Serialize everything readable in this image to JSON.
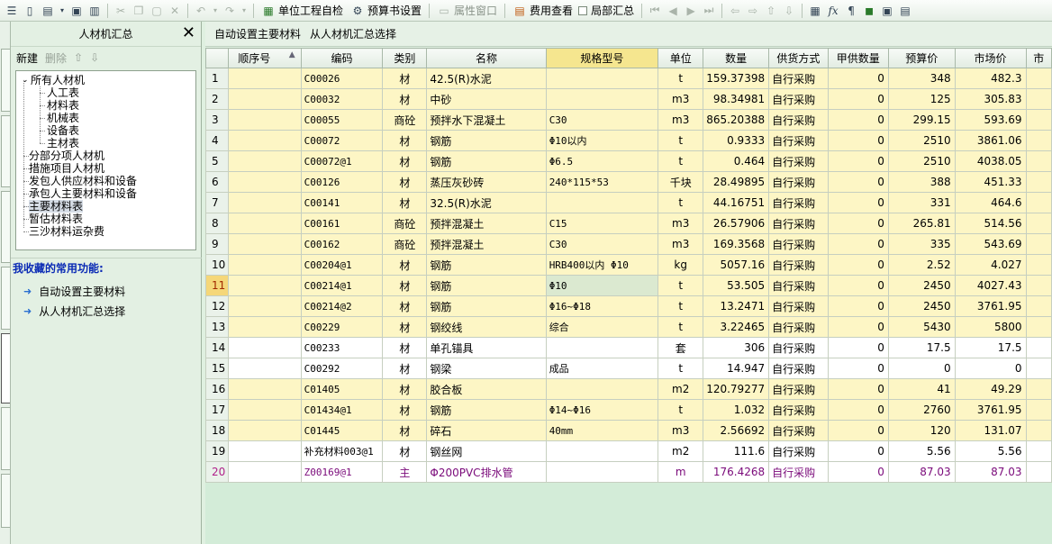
{
  "toolbar": {
    "check_label": "单位工程自检",
    "budget_settings_label": "预算书设置",
    "property_window_label": "属性窗口",
    "fee_view_label": "费用查看",
    "partial_summary_label": "局部汇总"
  },
  "left_panel": {
    "title": "人材机汇总",
    "new_label": "新建",
    "delete_label": "删除",
    "tree": [
      {
        "label": "所有人材机",
        "level": 0,
        "root": true
      },
      {
        "label": "人工表",
        "level": 1
      },
      {
        "label": "材料表",
        "level": 1
      },
      {
        "label": "机械表",
        "level": 1
      },
      {
        "label": "设备表",
        "level": 1
      },
      {
        "label": "主材表",
        "level": 1
      },
      {
        "label": "分部分项人材机",
        "level": 0
      },
      {
        "label": "措施项目人材机",
        "level": 0
      },
      {
        "label": "发包人供应材料和设备",
        "level": 0
      },
      {
        "label": "承包人主要材料和设备",
        "level": 0
      },
      {
        "label": "主要材料表",
        "level": 0,
        "selected": true
      },
      {
        "label": "暂估材料表",
        "level": 0
      },
      {
        "label": "三沙材料运杂费",
        "level": 0
      }
    ],
    "favorites_title": "我收藏的常用功能:",
    "favorites": [
      "自动设置主要材料",
      "从人材机汇总选择"
    ]
  },
  "main": {
    "action_auto_label": "自动设置主要材料",
    "action_select_label": "从人材机汇总选择",
    "columns": [
      "",
      "顺序号",
      "编码",
      "类别",
      "名称",
      "规格型号",
      "单位",
      "数量",
      "供货方式",
      "甲供数量",
      "预算价",
      "市场价",
      "市"
    ],
    "rows": [
      {
        "n": "1",
        "code": "C00026",
        "cat": "材",
        "name": "42.5(R)水泥",
        "spec": "",
        "unit": "t",
        "qty": "159.37398",
        "supply": "自行采购",
        "jia": "0",
        "budget": "348",
        "market": "482.3",
        "style": "y"
      },
      {
        "n": "2",
        "code": "C00032",
        "cat": "材",
        "name": "中砂",
        "spec": "",
        "unit": "m3",
        "qty": "98.34981",
        "supply": "自行采购",
        "jia": "0",
        "budget": "125",
        "market": "305.83",
        "style": "y"
      },
      {
        "n": "3",
        "code": "C00055",
        "cat": "商砼",
        "name": "预拌水下混凝土",
        "spec": "C30",
        "unit": "m3",
        "qty": "865.20388",
        "supply": "自行采购",
        "jia": "0",
        "budget": "299.15",
        "market": "593.69",
        "style": "y"
      },
      {
        "n": "4",
        "code": "C00072",
        "cat": "材",
        "name": "钢筋",
        "spec": "Φ10以内",
        "unit": "t",
        "qty": "0.9333",
        "supply": "自行采购",
        "jia": "0",
        "budget": "2510",
        "market": "3861.06",
        "style": "y"
      },
      {
        "n": "5",
        "code": "C00072@1",
        "cat": "材",
        "name": "钢筋",
        "spec": "Φ6.5",
        "unit": "t",
        "qty": "0.464",
        "supply": "自行采购",
        "jia": "0",
        "budget": "2510",
        "market": "4038.05",
        "style": "y"
      },
      {
        "n": "6",
        "code": "C00126",
        "cat": "材",
        "name": "蒸压灰砂砖",
        "spec": "240*115*53",
        "unit": "千块",
        "qty": "28.49895",
        "supply": "自行采购",
        "jia": "0",
        "budget": "388",
        "market": "451.33",
        "style": "y"
      },
      {
        "n": "7",
        "code": "C00141",
        "cat": "材",
        "name": "32.5(R)水泥",
        "spec": "",
        "unit": "t",
        "qty": "44.16751",
        "supply": "自行采购",
        "jia": "0",
        "budget": "331",
        "market": "464.6",
        "style": "y"
      },
      {
        "n": "8",
        "code": "C00161",
        "cat": "商砼",
        "name": "预拌混凝土",
        "spec": "C15",
        "unit": "m3",
        "qty": "26.57906",
        "supply": "自行采购",
        "jia": "0",
        "budget": "265.81",
        "market": "514.56",
        "style": "y"
      },
      {
        "n": "9",
        "code": "C00162",
        "cat": "商砼",
        "name": "预拌混凝土",
        "spec": "C30",
        "unit": "m3",
        "qty": "169.3568",
        "supply": "自行采购",
        "jia": "0",
        "budget": "335",
        "market": "543.69",
        "style": "y"
      },
      {
        "n": "10",
        "code": "C00204@1",
        "cat": "材",
        "name": "钢筋",
        "spec": "HRB400以内 Φ10",
        "unit": "kg",
        "qty": "5057.16",
        "supply": "自行采购",
        "jia": "0",
        "budget": "2.52",
        "market": "4.027",
        "style": "y"
      },
      {
        "n": "11",
        "code": "C00214@1",
        "cat": "材",
        "name": "钢筋",
        "spec": "Φ10",
        "unit": "t",
        "qty": "53.505",
        "supply": "自行采购",
        "jia": "0",
        "budget": "2450",
        "market": "4027.43",
        "style": "y",
        "current": true
      },
      {
        "n": "12",
        "code": "C00214@2",
        "cat": "材",
        "name": "钢筋",
        "spec": "Φ16~Φ18",
        "unit": "t",
        "qty": "13.2471",
        "supply": "自行采购",
        "jia": "0",
        "budget": "2450",
        "market": "3761.95",
        "style": "y"
      },
      {
        "n": "13",
        "code": "C00229",
        "cat": "材",
        "name": "钢绞线",
        "spec": "综合",
        "unit": "t",
        "qty": "3.22465",
        "supply": "自行采购",
        "jia": "0",
        "budget": "5430",
        "market": "5800",
        "style": "y"
      },
      {
        "n": "14",
        "code": "C00233",
        "cat": "材",
        "name": "单孔锚具",
        "spec": "",
        "unit": "套",
        "qty": "306",
        "supply": "自行采购",
        "jia": "0",
        "budget": "17.5",
        "market": "17.5",
        "style": "w"
      },
      {
        "n": "15",
        "code": "C00292",
        "cat": "材",
        "name": "钢梁",
        "spec": "成品",
        "unit": "t",
        "qty": "14.947",
        "supply": "自行采购",
        "jia": "0",
        "budget": "0",
        "market": "0",
        "style": "w"
      },
      {
        "n": "16",
        "code": "C01405",
        "cat": "材",
        "name": "胶合板",
        "spec": "",
        "unit": "m2",
        "qty": "120.79277",
        "supply": "自行采购",
        "jia": "0",
        "budget": "41",
        "market": "49.29",
        "style": "y"
      },
      {
        "n": "17",
        "code": "C01434@1",
        "cat": "材",
        "name": "钢筋",
        "spec": "Φ14~Φ16",
        "unit": "t",
        "qty": "1.032",
        "supply": "自行采购",
        "jia": "0",
        "budget": "2760",
        "market": "3761.95",
        "style": "y"
      },
      {
        "n": "18",
        "code": "C01445",
        "cat": "材",
        "name": "碎石",
        "spec": "40mm",
        "unit": "m3",
        "qty": "2.56692",
        "supply": "自行采购",
        "jia": "0",
        "budget": "120",
        "market": "131.07",
        "style": "y"
      },
      {
        "n": "19",
        "code": "补充材料003@1",
        "cat": "材",
        "name": "钢丝网",
        "spec": "",
        "unit": "m2",
        "qty": "111.6",
        "supply": "自行采购",
        "jia": "0",
        "budget": "5.56",
        "market": "5.56",
        "style": "w"
      },
      {
        "n": "20",
        "code": "Z00169@1",
        "cat": "主",
        "name": "Φ200PVC排水管",
        "spec": "",
        "unit": "m",
        "qty": "176.4268",
        "supply": "自行采购",
        "jia": "0",
        "budget": "87.03",
        "market": "87.03",
        "style": "w",
        "purple": true
      }
    ]
  }
}
